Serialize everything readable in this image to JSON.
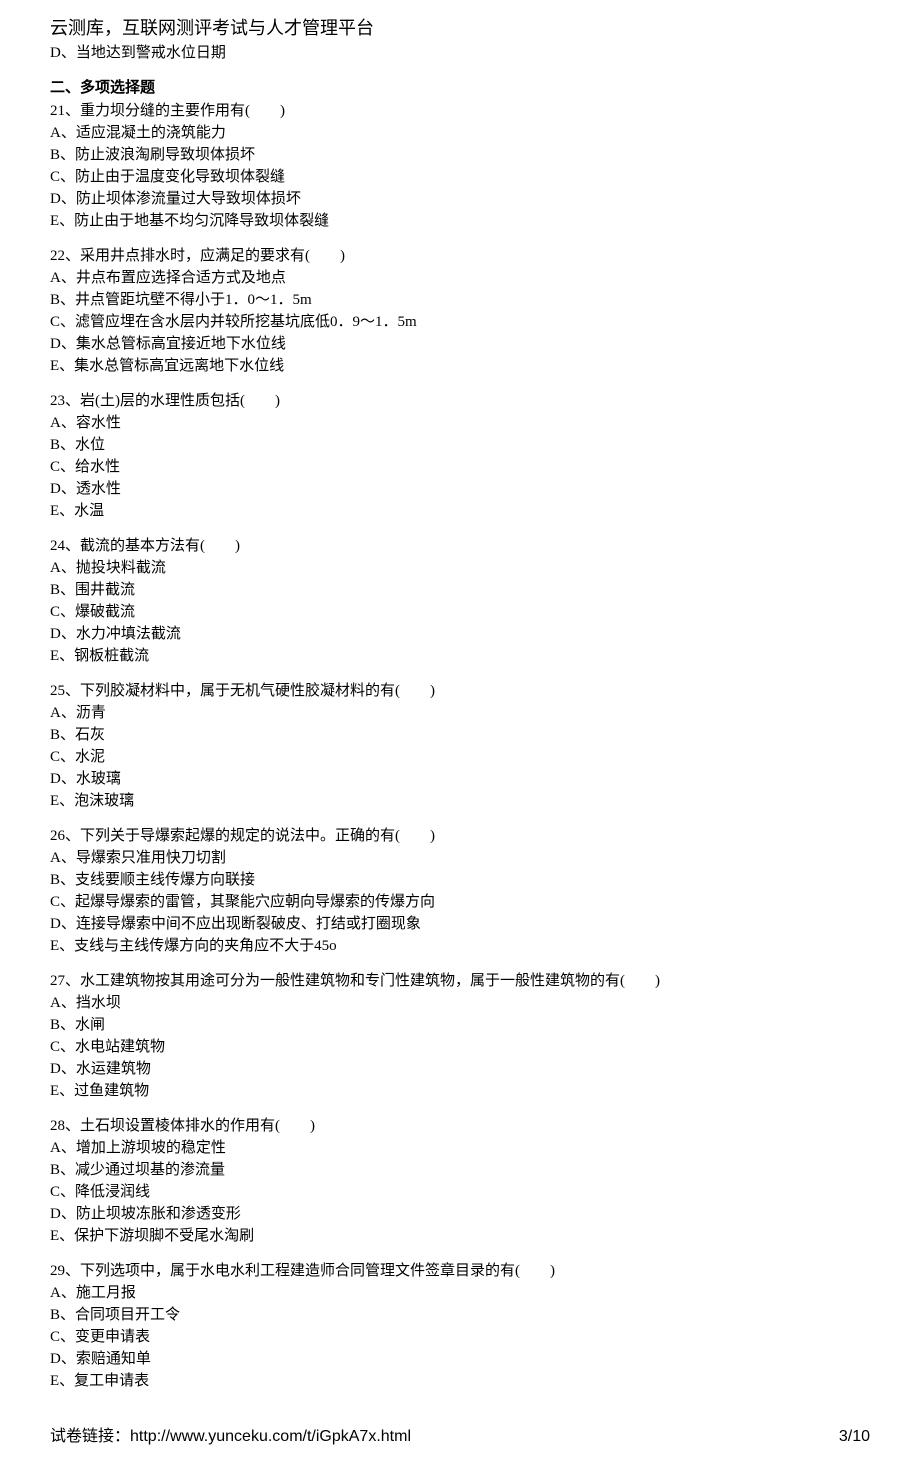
{
  "header": {
    "title": "云测库，互联网测评考试与人才管理平台"
  },
  "orphan_option": "D、当地达到警戒水位日期",
  "section_heading": "二、多项选择题",
  "questions": [
    {
      "stem": "21、重力坝分缝的主要作用有(　　)",
      "options": [
        "A、适应混凝土的浇筑能力",
        "B、防止波浪淘刷导致坝体损坏",
        "C、防止由于温度变化导致坝体裂缝",
        "D、防止坝体渗流量过大导致坝体损坏",
        "E、防止由于地基不均匀沉降导致坝体裂缝"
      ]
    },
    {
      "stem": "22、采用井点排水时，应满足的要求有(　　)",
      "options": [
        "A、井点布置应选择合适方式及地点",
        "B、井点管距坑壁不得小于1．0～1．5m",
        "C、滤管应埋在含水层内并较所挖基坑底低0．9～1．5m",
        "D、集水总管标高宜接近地下水位线",
        "E、集水总管标高宜远离地下水位线"
      ]
    },
    {
      "stem": "23、岩(土)层的水理性质包括(　　)",
      "options": [
        "A、容水性",
        "B、水位",
        "C、给水性",
        "D、透水性",
        "E、水温"
      ]
    },
    {
      "stem": "24、截流的基本方法有(　　)",
      "options": [
        "A、抛投块料截流",
        "B、围井截流",
        "C、爆破截流",
        "D、水力冲填法截流",
        "E、钢板桩截流"
      ]
    },
    {
      "stem": "25、下列胶凝材料中，属于无机气硬性胶凝材料的有(　　)",
      "options": [
        "A、沥青",
        "B、石灰",
        "C、水泥",
        "D、水玻璃",
        "E、泡沫玻璃"
      ]
    },
    {
      "stem": "26、下列关于导爆索起爆的规定的说法中。正确的有(　　)",
      "options": [
        "A、导爆索只准用快刀切割",
        "B、支线要顺主线传爆方向联接",
        "C、起爆导爆索的雷管，其聚能穴应朝向导爆索的传爆方向",
        "D、连接导爆索中间不应出现断裂破皮、打结或打圈现象",
        "E、支线与主线传爆方向的夹角应不大于45o"
      ]
    },
    {
      "stem": "27、水工建筑物按其用途可分为一般性建筑物和专门性建筑物，属于一般性建筑物的有(　　)",
      "options": [
        "A、挡水坝",
        "B、水闸",
        "C、水电站建筑物",
        "D、水运建筑物",
        "E、过鱼建筑物"
      ]
    },
    {
      "stem": "28、土石坝设置棱体排水的作用有(　　)",
      "options": [
        "A、增加上游坝坡的稳定性",
        "B、减少通过坝基的渗流量",
        "C、降低浸润线",
        "D、防止坝坡冻胀和渗透变形",
        "E、保护下游坝脚不受尾水淘刷"
      ]
    },
    {
      "stem": "29、下列选项中，属于水电水利工程建造师合同管理文件签章目录的有(　　)",
      "options": [
        "A、施工月报",
        "B、合同项目开工令",
        "C、变更申请表",
        "D、索赔通知单",
        "E、复工申请表"
      ]
    }
  ],
  "footer": {
    "link_label": "试卷链接：http://www.yunceku.com/t/iGpkA7x.html",
    "page_indicator": "3/10"
  }
}
